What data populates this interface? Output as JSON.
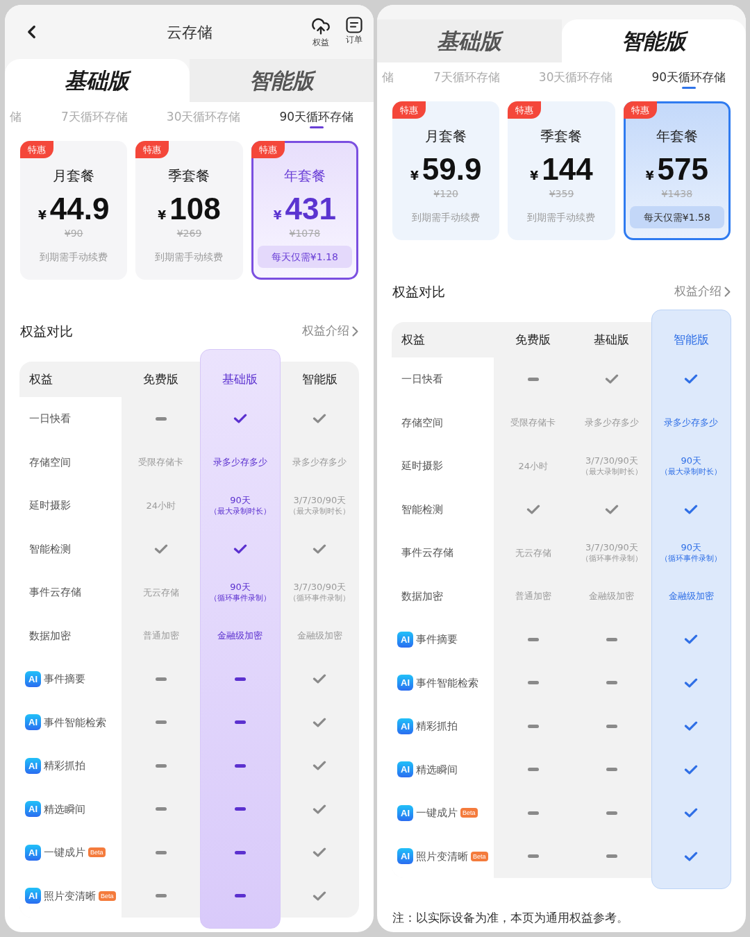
{
  "panels": [
    {
      "header": {
        "title": "云存储",
        "actions": [
          {
            "kind": "upload",
            "label": "权益"
          },
          {
            "kind": "orders",
            "label": "订单"
          }
        ]
      },
      "tabs": [
        {
          "label": "基础版",
          "selected": true
        },
        {
          "label": "智能版",
          "selected": false
        }
      ],
      "periods": [
        {
          "label": "储",
          "selected": false
        },
        {
          "label": "7天循环存储",
          "selected": false
        },
        {
          "label": "30天循环存储",
          "selected": false
        },
        {
          "label": "90天循环存储",
          "selected": true
        }
      ],
      "plans": [
        {
          "badge": "特惠",
          "name": "月套餐",
          "currency": "¥",
          "price": "44.9",
          "original_price": "¥90",
          "note": "到期需手动续费",
          "selected": false
        },
        {
          "badge": "特惠",
          "name": "季套餐",
          "currency": "¥",
          "price": "108",
          "original_price": "¥269",
          "note": "到期需手动续费",
          "selected": false
        },
        {
          "badge": "特惠",
          "name": "年套餐",
          "currency": "¥",
          "price": "431",
          "original_price": "¥1078",
          "note": "每天仅需¥1.18",
          "selected": true
        }
      ],
      "section": {
        "title": "权益对比",
        "link": "权益介绍"
      },
      "table": {
        "corner": "权益",
        "columns": [
          {
            "label": "免费版",
            "highlighted": false
          },
          {
            "label": "基础版",
            "highlighted": true
          },
          {
            "label": "智能版",
            "highlighted": false
          }
        ],
        "rows": [
          {
            "label": "一日快看",
            "cells": [
              {
                "kind": "dash"
              },
              {
                "kind": "check"
              },
              {
                "kind": "check"
              }
            ]
          },
          {
            "label": "存储空间",
            "cells": [
              {
                "kind": "text",
                "text": "受限存储卡"
              },
              {
                "kind": "text",
                "text": "录多少存多少"
              },
              {
                "kind": "text",
                "text": "录多少存多少"
              }
            ]
          },
          {
            "label": "延时摄影",
            "cells": [
              {
                "kind": "text",
                "text": "24小时"
              },
              {
                "kind": "text",
                "text": "90天",
                "note": "（最大录制时长）"
              },
              {
                "kind": "text",
                "text": "3/7/30/90天",
                "note": "（最大录制时长）"
              }
            ]
          },
          {
            "label": "智能检测",
            "cells": [
              {
                "kind": "check"
              },
              {
                "kind": "check"
              },
              {
                "kind": "check"
              }
            ]
          },
          {
            "label": "事件云存储",
            "cells": [
              {
                "kind": "text",
                "text": "无云存储"
              },
              {
                "kind": "text",
                "text": "90天",
                "note": "（循环事件录制）"
              },
              {
                "kind": "text",
                "text": "3/7/30/90天",
                "note": "（循环事件录制）"
              }
            ]
          },
          {
            "label": "数据加密",
            "cells": [
              {
                "kind": "text",
                "text": "普通加密"
              },
              {
                "kind": "text",
                "text": "金融级加密"
              },
              {
                "kind": "text",
                "text": "金融级加密"
              }
            ]
          },
          {
            "badge": "AI",
            "label": "事件摘要",
            "cells": [
              {
                "kind": "dash"
              },
              {
                "kind": "dash"
              },
              {
                "kind": "check"
              }
            ]
          },
          {
            "badge": "AI",
            "label": "事件智能检索",
            "cells": [
              {
                "kind": "dash"
              },
              {
                "kind": "dash"
              },
              {
                "kind": "check"
              }
            ]
          },
          {
            "badge": "AI",
            "label": "精彩抓拍",
            "cells": [
              {
                "kind": "dash"
              },
              {
                "kind": "dash"
              },
              {
                "kind": "check"
              }
            ]
          },
          {
            "badge": "AI",
            "label": "精选瞬间",
            "cells": [
              {
                "kind": "dash"
              },
              {
                "kind": "dash"
              },
              {
                "kind": "check"
              }
            ]
          },
          {
            "badge": "AI",
            "label": "一键成片",
            "tag": "Beta",
            "cells": [
              {
                "kind": "dash"
              },
              {
                "kind": "dash"
              },
              {
                "kind": "check"
              }
            ]
          },
          {
            "badge": "AI",
            "label": "照片变清晰",
            "tag": "Beta",
            "cells": [
              {
                "kind": "dash"
              },
              {
                "kind": "dash"
              },
              {
                "kind": "check"
              }
            ]
          }
        ]
      }
    },
    {
      "tabs": [
        {
          "label": "基础版",
          "selected": false
        },
        {
          "label": "智能版",
          "selected": true
        }
      ],
      "periods": [
        {
          "label": "储",
          "selected": false
        },
        {
          "label": "7天循环存储",
          "selected": false
        },
        {
          "label": "30天循环存储",
          "selected": false
        },
        {
          "label": "90天循环存储",
          "selected": true
        }
      ],
      "plans": [
        {
          "badge": "特惠",
          "name": "月套餐",
          "currency": "¥",
          "price": "59.9",
          "original_price": "¥120",
          "note": "到期需手动续费",
          "selected": false
        },
        {
          "badge": "特惠",
          "name": "季套餐",
          "currency": "¥",
          "price": "144",
          "original_price": "¥359",
          "note": "到期需手动续费",
          "selected": false
        },
        {
          "badge": "特惠",
          "name": "年套餐",
          "currency": "¥",
          "price": "575",
          "original_price": "¥1438",
          "note": "每天仅需¥1.58",
          "selected": true
        }
      ],
      "section": {
        "title": "权益对比",
        "link": "权益介绍"
      },
      "table": {
        "corner": "权益",
        "columns": [
          {
            "label": "免费版",
            "highlighted": false
          },
          {
            "label": "基础版",
            "highlighted": false
          },
          {
            "label": "智能版",
            "highlighted": true
          }
        ],
        "rows": [
          {
            "label": "一日快看",
            "cells": [
              {
                "kind": "dash"
              },
              {
                "kind": "check"
              },
              {
                "kind": "check"
              }
            ]
          },
          {
            "label": "存储空间",
            "cells": [
              {
                "kind": "text",
                "text": "受限存储卡"
              },
              {
                "kind": "text",
                "text": "录多少存多少"
              },
              {
                "kind": "text",
                "text": "录多少存多少"
              }
            ]
          },
          {
            "label": "延时摄影",
            "cells": [
              {
                "kind": "text",
                "text": "24小时"
              },
              {
                "kind": "text",
                "text": "3/7/30/90天",
                "note": "（最大录制时长）"
              },
              {
                "kind": "text",
                "text": "90天",
                "note": "（最大录制时长）"
              }
            ]
          },
          {
            "label": "智能检测",
            "cells": [
              {
                "kind": "check"
              },
              {
                "kind": "check"
              },
              {
                "kind": "check"
              }
            ]
          },
          {
            "label": "事件云存储",
            "cells": [
              {
                "kind": "text",
                "text": "无云存储"
              },
              {
                "kind": "text",
                "text": "3/7/30/90天",
                "note": "（循环事件录制）"
              },
              {
                "kind": "text",
                "text": "90天",
                "note": "（循环事件录制）"
              }
            ]
          },
          {
            "label": "数据加密",
            "cells": [
              {
                "kind": "text",
                "text": "普通加密"
              },
              {
                "kind": "text",
                "text": "金融级加密"
              },
              {
                "kind": "text",
                "text": "金融级加密"
              }
            ]
          },
          {
            "badge": "AI",
            "label": "事件摘要",
            "cells": [
              {
                "kind": "dash"
              },
              {
                "kind": "dash"
              },
              {
                "kind": "check"
              }
            ]
          },
          {
            "badge": "AI",
            "label": "事件智能检索",
            "cells": [
              {
                "kind": "dash"
              },
              {
                "kind": "dash"
              },
              {
                "kind": "check"
              }
            ]
          },
          {
            "badge": "AI",
            "label": "精彩抓拍",
            "cells": [
              {
                "kind": "dash"
              },
              {
                "kind": "dash"
              },
              {
                "kind": "check"
              }
            ]
          },
          {
            "badge": "AI",
            "label": "精选瞬间",
            "cells": [
              {
                "kind": "dash"
              },
              {
                "kind": "dash"
              },
              {
                "kind": "check"
              }
            ]
          },
          {
            "badge": "AI",
            "label": "一键成片",
            "tag": "Beta",
            "cells": [
              {
                "kind": "dash"
              },
              {
                "kind": "dash"
              },
              {
                "kind": "check"
              }
            ]
          },
          {
            "badge": "AI",
            "label": "照片变清晰",
            "tag": "Beta",
            "cells": [
              {
                "kind": "dash"
              },
              {
                "kind": "dash"
              },
              {
                "kind": "check"
              }
            ]
          }
        ]
      },
      "note": "注：以实际设备为准，本页为通用权益参考。"
    }
  ]
}
